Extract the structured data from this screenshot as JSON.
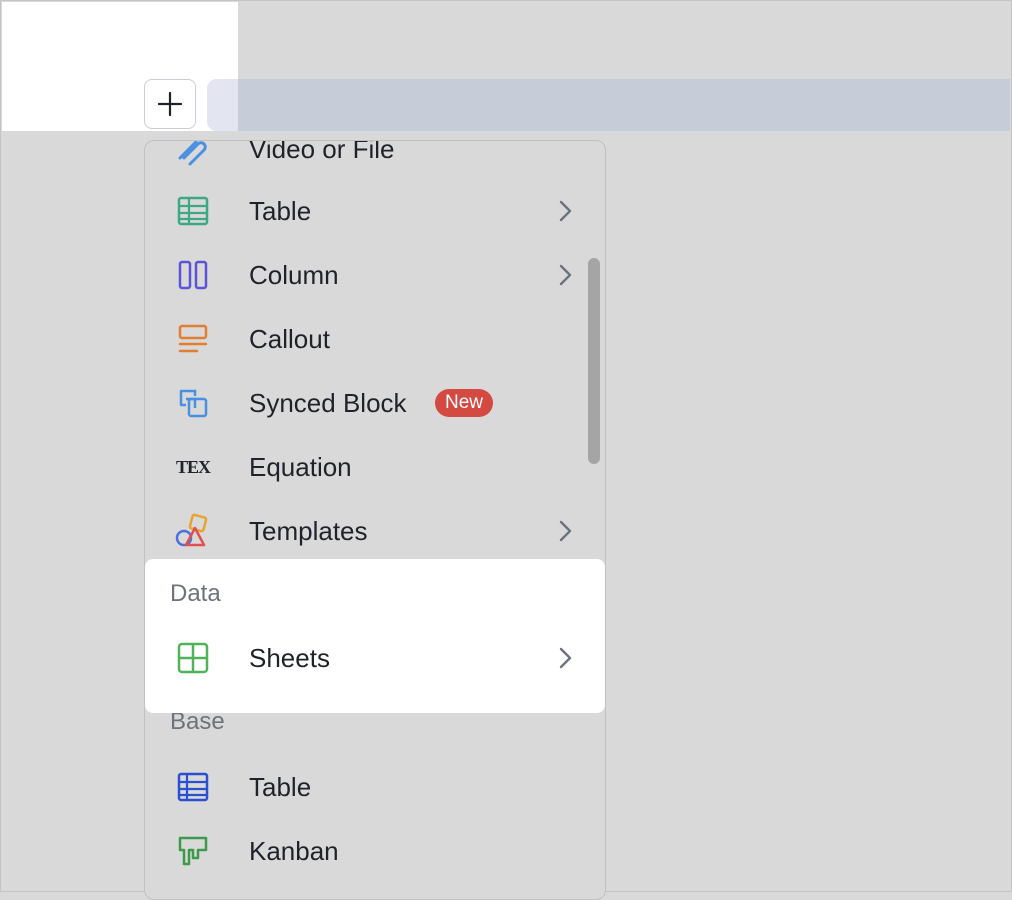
{
  "toolbar": {
    "add_icon": "plus-icon"
  },
  "menu": {
    "items": [
      {
        "label": "Video or File",
        "icon": "attachment-icon",
        "submenu": false
      },
      {
        "label": "Table",
        "icon": "table-icon",
        "submenu": true
      },
      {
        "label": "Column",
        "icon": "column-icon",
        "submenu": true
      },
      {
        "label": "Callout",
        "icon": "callout-icon",
        "submenu": false
      },
      {
        "label": "Synced Block",
        "icon": "synced-block-icon",
        "submenu": false,
        "badge": "New"
      },
      {
        "label": "Equation",
        "icon": "tex-icon",
        "submenu": false
      },
      {
        "label": "Templates",
        "icon": "templates-icon",
        "submenu": true
      }
    ],
    "tex_glyph": "TEX",
    "data_section": {
      "title": "Data",
      "items": [
        {
          "label": "Sheets",
          "icon": "sheets-icon",
          "submenu": true
        }
      ]
    },
    "base_section": {
      "title": "Base",
      "items": [
        {
          "label": "Table",
          "icon": "base-table-icon",
          "submenu": false
        },
        {
          "label": "Kanban",
          "icon": "kanban-icon",
          "submenu": false
        }
      ]
    }
  },
  "colors": {
    "badge": "#d24a41",
    "table_icon": "#3ea884",
    "column_icon": "#5b55d6",
    "callout_icon": "#e07e33",
    "synced_icon": "#4a90e2",
    "sheets_icon": "#4fb35a",
    "base_table_icon": "#2b4fd1",
    "kanban_icon": "#3d9a4a"
  }
}
